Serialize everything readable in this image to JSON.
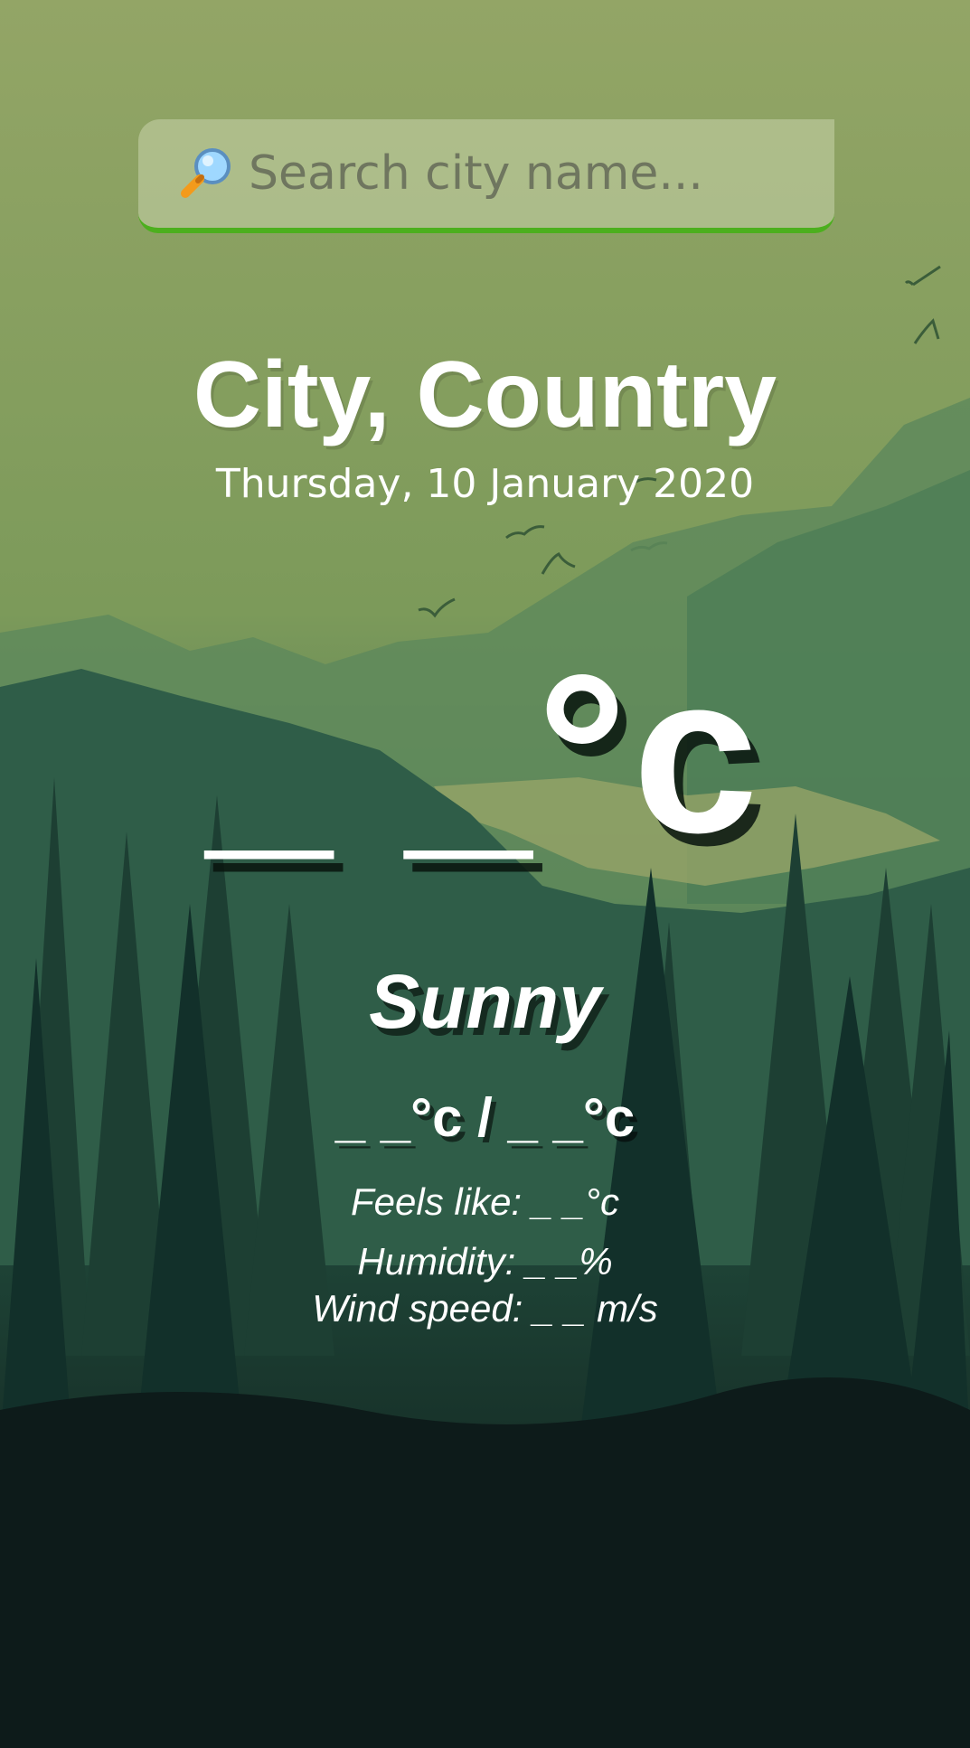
{
  "search": {
    "placeholder": "Search city name...",
    "icon": "magnifier-icon"
  },
  "location": {
    "name": "City, Country",
    "date": "Thursday, 10 January 2020"
  },
  "current": {
    "temperature": "_ _°c",
    "condition": "Sunny",
    "high_low": "_ _°c / _ _°c",
    "feels_like": "Feels like: _ _°c",
    "humidity": "Humidity: _ _%",
    "wind_speed": "Wind speed: _ _ m/s"
  },
  "colors": {
    "accent": "#4caf1e",
    "text": "#ffffff"
  }
}
